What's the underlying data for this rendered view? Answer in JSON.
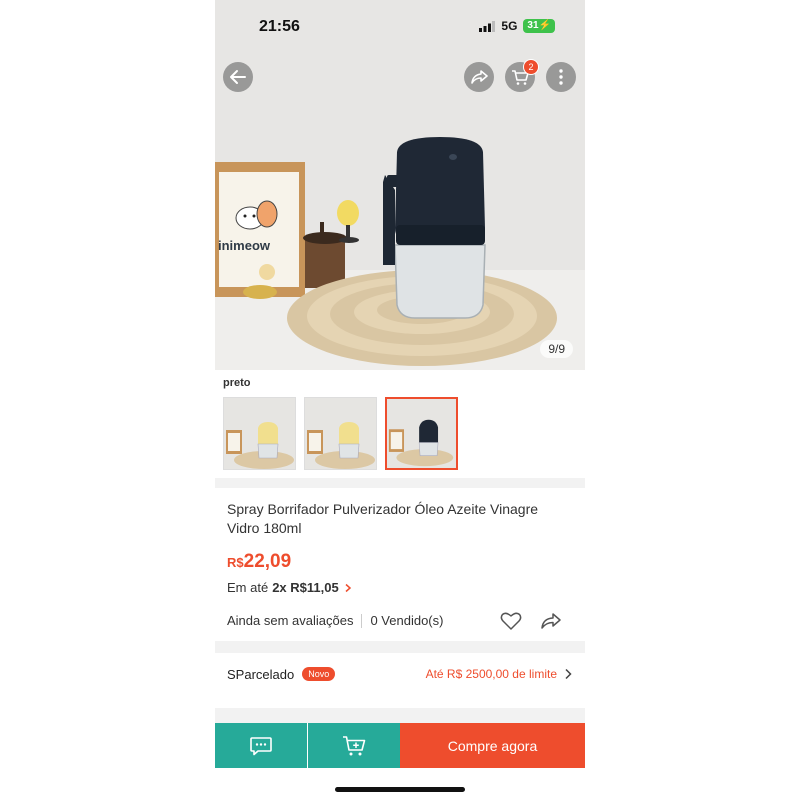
{
  "status_bar": {
    "time": "21:56",
    "network": "5G",
    "battery": "31"
  },
  "header": {
    "back_icon": "arrow-left-icon",
    "share_icon": "share-icon",
    "cart_icon": "cart-icon",
    "cart_badge": "2",
    "more_icon": "more-vertical-icon"
  },
  "gallery": {
    "counter": "9/9",
    "scene_text": "inimeow",
    "variant_label": "preto",
    "thumbnails": [
      {
        "variant": "yellow",
        "selected": false
      },
      {
        "variant": "yellow",
        "selected": false
      },
      {
        "variant": "black",
        "selected": true
      }
    ]
  },
  "product": {
    "title": "Spray Borrifador Pulverizador Óleo Azeite Vinagre Vidro 180ml",
    "price_currency": "R$",
    "price_value": "22,09",
    "installment_prefix": "Em até",
    "installment_detail": "2x R$11,05",
    "ratings_text": "Ainda sem avaliações",
    "sold_text": "0 Vendido(s)"
  },
  "sparcelado": {
    "label": "SParcelado",
    "badge": "Novo",
    "limit_text": "Até R$ 2500,00 de limite"
  },
  "bottom_bar": {
    "chat_icon": "chat-icon",
    "add_cart_icon": "add-to-cart-icon",
    "buy_label": "Compre agora"
  },
  "colors": {
    "accent": "#ee4d2d",
    "teal": "#26aa99",
    "battery_green": "#3ec24b"
  }
}
